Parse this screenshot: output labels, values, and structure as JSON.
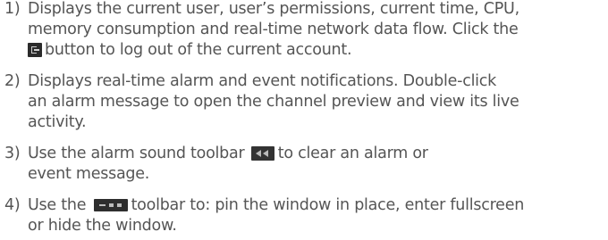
{
  "items": [
    {
      "number": "1)",
      "lines": [
        "Displays the current user, user’s permissions, current time, CPU,",
        "memory consumption and real-time network data flow. Click the"
      ],
      "after_icon": "button to log out of the current account.",
      "icon": "logout-icon"
    },
    {
      "number": "2)",
      "lines": [
        "Displays real-time alarm and event notifications. Double-click",
        "an alarm message to open the channel preview and view its live",
        "activity."
      ]
    },
    {
      "number": "3)",
      "before_icon": "Use the alarm sound toolbar",
      "after_icon": "to clear an alarm or",
      "line2": "event message.",
      "icon": "alarm-sound-toolbar-icon"
    },
    {
      "number": "4)",
      "before_icon": "Use the",
      "after_icon": "toolbar to: pin the window in place, enter fullscreen",
      "line2": "or hide the window.",
      "icon": "window-toolbar-icon"
    }
  ]
}
